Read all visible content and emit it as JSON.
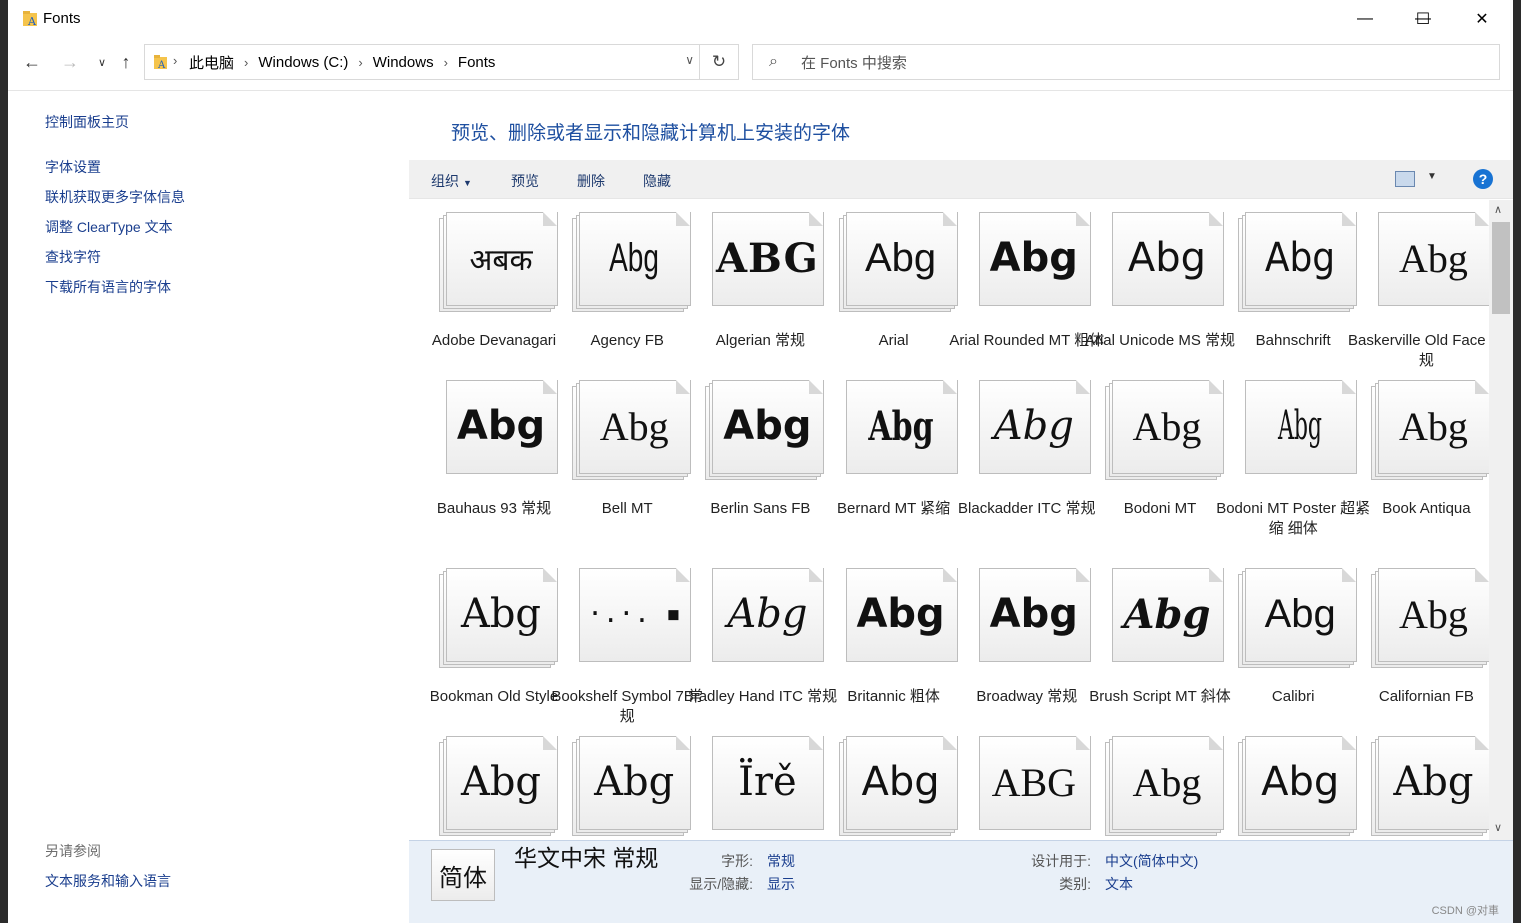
{
  "window": {
    "title": "Fonts",
    "minimize_glyph": "—",
    "maximize_glyph": "☐",
    "close_glyph": "✕"
  },
  "nav": {
    "back_icon": "arrow-left-icon",
    "forward_icon": "arrow-right-icon",
    "recent_icon": "chevron-down-icon",
    "up_icon": "arrow-up-icon"
  },
  "address": {
    "crumbs": [
      "此电脑",
      "Windows (C:)",
      "Windows",
      "Fonts"
    ]
  },
  "search": {
    "placeholder": "在 Fonts 中搜索"
  },
  "left_pane": {
    "home": "控制面板主页",
    "links": [
      "字体设置",
      "联机获取更多字体信息",
      "调整 ClearType 文本",
      "查找字符",
      "下载所有语言的字体"
    ],
    "see_also_title": "另请参阅",
    "see_also_link": "文本服务和输入语言"
  },
  "main": {
    "heading": "预览、删除或者显示和隐藏计算机上安装的字体",
    "commands": {
      "organize": "组织",
      "preview": "预览",
      "delete": "删除",
      "hide": "隐藏",
      "help": "?"
    }
  },
  "fonts": [
    {
      "name": "Adobe Devanagari",
      "sample": "अबक",
      "stack": true
    },
    {
      "name": "Agency FB",
      "sample": "Abg",
      "stack": true
    },
    {
      "name": "Algerian 常规",
      "sample": "ABG",
      "stack": false
    },
    {
      "name": "Arial",
      "sample": "Abg",
      "stack": true
    },
    {
      "name": "Arial Rounded MT 粗体",
      "sample": "Abg",
      "stack": false
    },
    {
      "name": "Arial Unicode MS 常规",
      "sample": "Abg",
      "stack": false
    },
    {
      "name": "Bahnschrift",
      "sample": "Abg",
      "stack": true
    },
    {
      "name": "Baskerville Old Face 常规",
      "sample": "Abg",
      "stack": false
    },
    {
      "name": "Bauhaus 93 常规",
      "sample": "Abg",
      "stack": false
    },
    {
      "name": "Bell MT",
      "sample": "Abg",
      "stack": true
    },
    {
      "name": "Berlin Sans FB",
      "sample": "Abg",
      "stack": true
    },
    {
      "name": "Bernard MT 紧缩",
      "sample": "Abg",
      "stack": false
    },
    {
      "name": "Blackadder ITC 常规",
      "sample": "Abg",
      "stack": false
    },
    {
      "name": "Bodoni MT",
      "sample": "Abg",
      "stack": true
    },
    {
      "name": "Bodoni MT Poster 超紧缩 细体",
      "sample": "Abg",
      "stack": false
    },
    {
      "name": "Book Antiqua",
      "sample": "Abg",
      "stack": true
    },
    {
      "name": "Bookman Old Style",
      "sample": "Abg",
      "stack": true
    },
    {
      "name": "Bookshelf Symbol 7 常规",
      "sample": "·.·.  ▪",
      "stack": false
    },
    {
      "name": "Bradley Hand ITC 常规",
      "sample": "Abg",
      "stack": false
    },
    {
      "name": "Britannic 粗体",
      "sample": "Abg",
      "stack": false
    },
    {
      "name": "Broadway 常规",
      "sample": "Abg",
      "stack": false
    },
    {
      "name": "Brush Script MT 斜体",
      "sample": "Abg",
      "stack": false
    },
    {
      "name": "Calibri",
      "sample": "Abg",
      "stack": true
    },
    {
      "name": "Californian FB",
      "sample": "Abg",
      "stack": true
    },
    {
      "name": "",
      "sample": "Abg",
      "stack": true
    },
    {
      "name": "",
      "sample": "Abg",
      "stack": true
    },
    {
      "name": "",
      "sample": "Ïrě",
      "stack": false
    },
    {
      "name": "",
      "sample": "Abg",
      "stack": true
    },
    {
      "name": "",
      "sample": "ABG",
      "stack": false
    },
    {
      "name": "",
      "sample": "Abg",
      "stack": true
    },
    {
      "name": "",
      "sample": "Abg",
      "stack": true
    },
    {
      "name": "",
      "sample": "Abg",
      "stack": true
    }
  ],
  "details": {
    "icon_text": "简体",
    "font_name": "华文中宋 常规",
    "style_key": "字形:",
    "style_value": "常规",
    "visibility_key": "显示/隐藏:",
    "visibility_value": "显示",
    "designed_for_key": "设计用于:",
    "designed_for_value": "中文(简体中文)",
    "category_key": "类别:",
    "category_value": "文本"
  },
  "watermark": "CSDN @对車"
}
